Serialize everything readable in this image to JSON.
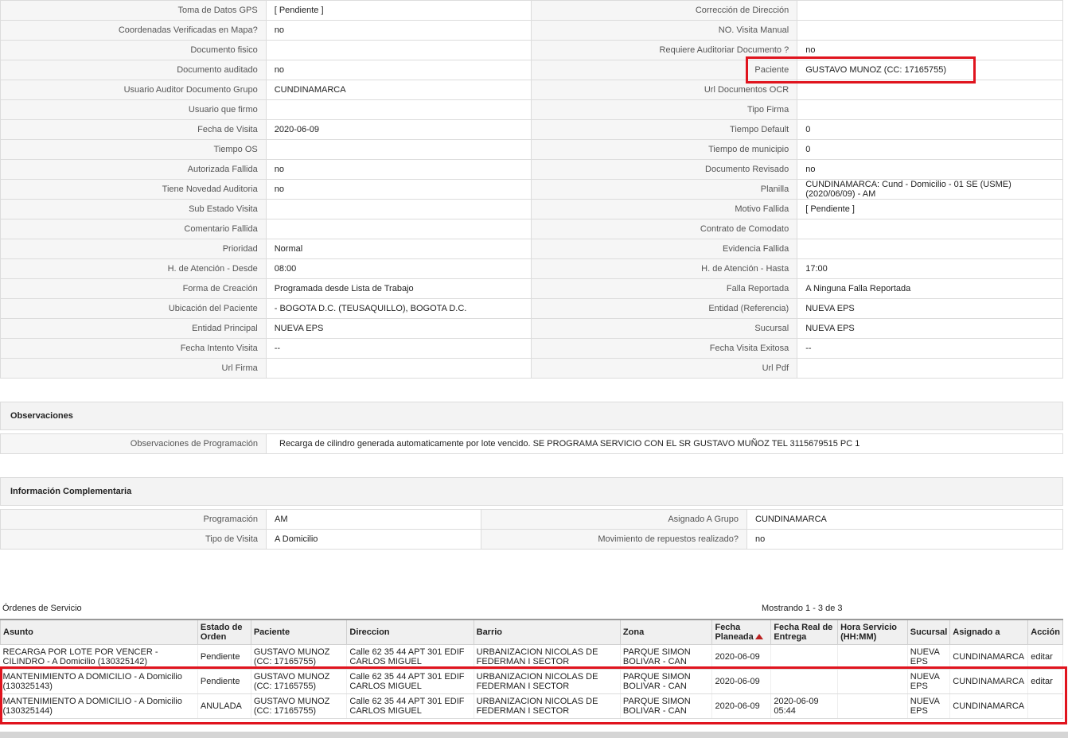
{
  "detail_rows": [
    {
      "l1": "Toma de Datos GPS",
      "v1": "[ Pendiente ]",
      "l2": "Corrección de Dirección",
      "v2": ""
    },
    {
      "l1": "Coordenadas Verificadas en Mapa?",
      "v1": "no",
      "l2": "NO. Visita Manual",
      "v2": ""
    },
    {
      "l1": "Documento fisico",
      "v1": "",
      "l2": "Requiere Auditoriar Documento ?",
      "v2": "no"
    },
    {
      "l1": "Documento auditado",
      "v1": "no",
      "l2": "Paciente",
      "v2": "GUSTAVO MUNOZ (CC: 17165755)"
    },
    {
      "l1": "Usuario Auditor Documento Grupo",
      "v1": "CUNDINAMARCA",
      "l2": "Url Documentos OCR",
      "v2": ""
    },
    {
      "l1": "Usuario que firmo",
      "v1": "",
      "l2": "Tipo Firma",
      "v2": ""
    },
    {
      "l1": "Fecha de Visita",
      "v1": "2020-06-09",
      "l2": "Tiempo Default",
      "v2": "0"
    },
    {
      "l1": "Tiempo OS",
      "v1": "",
      "l2": "Tiempo de municipio",
      "v2": "0"
    },
    {
      "l1": "Autorizada Fallida",
      "v1": "no",
      "l2": "Documento Revisado",
      "v2": "no"
    },
    {
      "l1": "Tiene Novedad Auditoria",
      "v1": "no",
      "l2": "Planilla",
      "v2": "CUNDINAMARCA: Cund - Domicilio - 01 SE (USME) (2020/06/09) - AM"
    },
    {
      "l1": "Sub Estado Visita",
      "v1": "",
      "l2": "Motivo Fallida",
      "v2": "[ Pendiente ]"
    },
    {
      "l1": "Comentario Fallida",
      "v1": "",
      "l2": "Contrato de Comodato",
      "v2": ""
    },
    {
      "l1": "Prioridad",
      "v1": "Normal",
      "l2": "Evidencia Fallida",
      "v2": ""
    },
    {
      "l1": "H. de Atención - Desde",
      "v1": "08:00",
      "l2": "H. de Atención - Hasta",
      "v2": "17:00"
    },
    {
      "l1": "Forma de Creación",
      "v1": "Programada desde Lista de Trabajo",
      "l2": "Falla Reportada",
      "v2": "A Ninguna Falla Reportada"
    },
    {
      "l1": "Ubicación del Paciente",
      "v1": "- BOGOTA D.C. (TEUSAQUILLO), BOGOTA D.C.",
      "l2": "Entidad (Referencia)",
      "v2": "NUEVA EPS"
    },
    {
      "l1": "Entidad Principal",
      "v1": "NUEVA EPS",
      "l2": "Sucursal",
      "v2": "NUEVA EPS"
    },
    {
      "l1": "Fecha Intento Visita",
      "v1": "--",
      "l2": "Fecha Visita Exitosa",
      "v2": "--"
    },
    {
      "l1": "Url Firma",
      "v1": "",
      "l2": "Url Pdf",
      "v2": ""
    }
  ],
  "observaciones": {
    "title": "Observaciones",
    "label": "Observaciones de Programación",
    "value": "Recarga de cilindro generada automaticamente por lote vencido. SE PROGRAMA SERVICIO CON EL SR GUSTAVO MUÑOZ TEL 3115679515 PC 1"
  },
  "complementaria": {
    "title": "Información Complementaria",
    "rows": [
      {
        "l1": "Programación",
        "v1": "AM",
        "l2": "Asignado A Grupo",
        "v2": "CUNDINAMARCA"
      },
      {
        "l1": "Tipo de Visita",
        "v1": "A Domicilio",
        "l2": "Movimiento de repuestos realizado?",
        "v2": "no"
      }
    ]
  },
  "orders": {
    "title": "Órdenes de Servicio",
    "count_text": "Mostrando 1 - 3 de 3",
    "headers": [
      "Asunto",
      "Estado de Orden",
      "Paciente",
      "Direccion",
      "Barrio",
      "Zona",
      "Fecha Planeada",
      "Fecha Real de Entrega",
      "Hora Servicio (HH:MM)",
      "Sucursal",
      "Asignado a",
      "Acción"
    ],
    "rows": [
      {
        "asunto": "RECARGA POR LOTE POR VENCER - CILINDRO - A Domicilio (130325142)",
        "estado": "Pendiente",
        "paciente": "GUSTAVO MUNOZ (CC: 17165755)",
        "direccion": "Calle 62 35 44 APT 301 EDIF CARLOS MIGUEL",
        "barrio": "URBANIZACION NICOLAS DE FEDERMAN I SECTOR",
        "zona": "PARQUE SIMON BOLIVAR - CAN",
        "fecha_planeada": "2020-06-09",
        "fecha_real": "",
        "hora": "",
        "sucursal": "NUEVA EPS",
        "asignado": "CUNDINAMARCA",
        "accion": "editar"
      },
      {
        "asunto": "MANTENIMIENTO A DOMICILIO - A Domicilio (130325143)",
        "estado": "Pendiente",
        "paciente": "GUSTAVO MUNOZ (CC: 17165755)",
        "direccion": "Calle 62 35 44 APT 301 EDIF CARLOS MIGUEL",
        "barrio": "URBANIZACION NICOLAS DE FEDERMAN I SECTOR",
        "zona": "PARQUE SIMON BOLIVAR - CAN",
        "fecha_planeada": "2020-06-09",
        "fecha_real": "",
        "hora": "",
        "sucursal": "NUEVA EPS",
        "asignado": "CUNDINAMARCA",
        "accion": "editar"
      },
      {
        "asunto": "MANTENIMIENTO A DOMICILIO - A Domicilio (130325144)",
        "estado": "ANULADA",
        "paciente": "GUSTAVO MUNOZ (CC: 17165755)",
        "direccion": "Calle 62 35 44 APT 301 EDIF CARLOS MIGUEL",
        "barrio": "URBANIZACION NICOLAS DE FEDERMAN I SECTOR",
        "zona": "PARQUE SIMON BOLIVAR - CAN",
        "fecha_planeada": "2020-06-09",
        "fecha_real": "2020-06-09 05:44",
        "hora": "",
        "sucursal": "NUEVA EPS",
        "asignado": "CUNDINAMARCA",
        "accion": ""
      }
    ]
  },
  "colors": {
    "highlight": "#e0141e",
    "label_bg": "#f6f6f6",
    "border": "#dcdcdc"
  }
}
